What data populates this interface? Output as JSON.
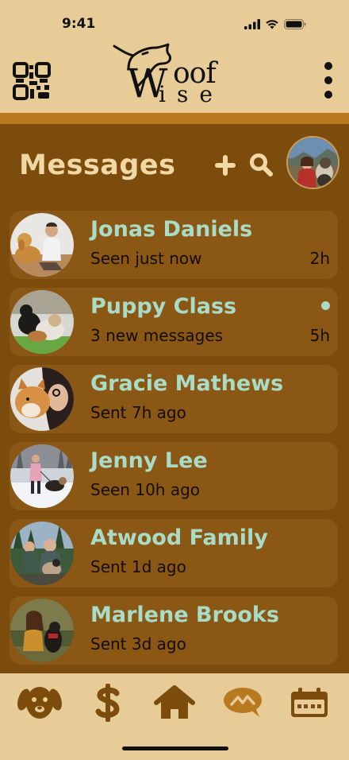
{
  "status_bar": {
    "time": "9:41"
  },
  "header": {
    "logo_text_top": "oof",
    "logo_text_bottom": "ise",
    "logo_letter_w": "W"
  },
  "title_row": {
    "title": "Messages"
  },
  "messages": [
    {
      "name": "Jonas Daniels",
      "subtitle": "Seen just now",
      "time": "2h",
      "unread": false
    },
    {
      "name": "Puppy Class",
      "subtitle": "3 new messages",
      "time": "5h",
      "unread": true
    },
    {
      "name": "Gracie Mathews",
      "subtitle": "Sent 7h ago",
      "time": "",
      "unread": false
    },
    {
      "name": "Jenny Lee",
      "subtitle": "Seen 10h ago",
      "time": "",
      "unread": false
    },
    {
      "name": "Atwood Family",
      "subtitle": "Sent 1d ago",
      "time": "",
      "unread": false
    },
    {
      "name": "Marlene Brooks",
      "subtitle": "Sent 3d ago",
      "time": "",
      "unread": false
    }
  ],
  "tabbar": {
    "tabs": [
      {
        "icon": "dog-face-icon",
        "active": false
      },
      {
        "icon": "dollar-icon",
        "active": false
      },
      {
        "icon": "home-icon",
        "active": false
      },
      {
        "icon": "chat-bubble-icon",
        "active": true
      },
      {
        "icon": "calendar-icon",
        "active": false
      }
    ]
  },
  "colors": {
    "background": "#7b4c0c",
    "header": "#e8cc97",
    "card": "#8a5714",
    "accent_name": "#a9dcc6",
    "title": "#f1d9a6",
    "icon_dark": "#7b4c0c"
  }
}
